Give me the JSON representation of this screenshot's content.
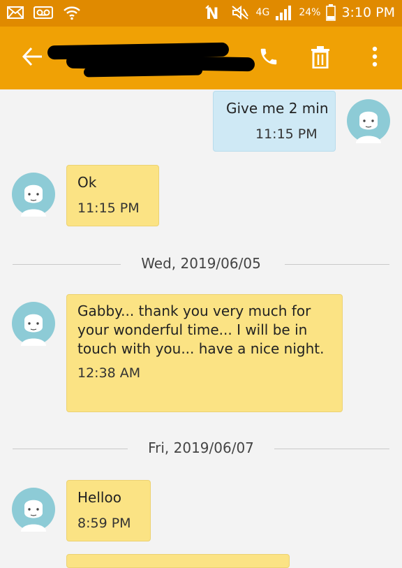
{
  "status_bar": {
    "battery": "24%",
    "network": "4G",
    "time": "3:10 PM"
  },
  "colors": {
    "status_bar": "#e08a00",
    "app_bar": "#f0a105",
    "incoming_bubble": "#fbe384",
    "outgoing_bubble": "#cfe9f5",
    "avatar": "#8dcbd6"
  },
  "icons": [
    "email-icon",
    "voicemail-icon",
    "wifi-icon",
    "nfc-icon",
    "mute-icon",
    "signal-icon",
    "battery-icon",
    "back-arrow-icon",
    "phone-icon",
    "trash-icon",
    "more-vert-icon",
    "avatar-icon"
  ],
  "messages": [
    {
      "direction": "outgoing",
      "text": "Give me 2 min",
      "time": "11:15 PM"
    },
    {
      "direction": "incoming",
      "text": "Ok",
      "time": "11:15 PM"
    },
    {
      "direction": "incoming",
      "text": "Gabby... thank you very much for your wonderful time... I will be in touch with you... have a nice night.",
      "time": "12:38 AM"
    },
    {
      "direction": "incoming",
      "text": "Helloo",
      "time": "8:59 PM"
    }
  ],
  "date_separators": [
    "Wed, 2019/06/05",
    "Fri, 2019/06/07"
  ]
}
